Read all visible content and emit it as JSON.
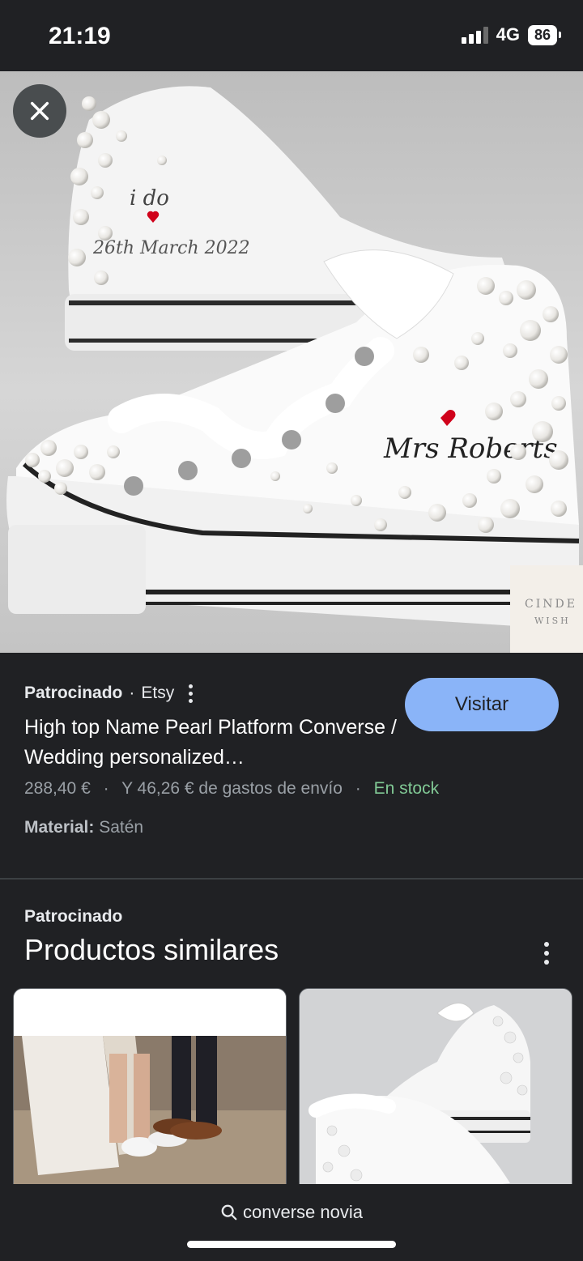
{
  "status_bar": {
    "time": "21:19",
    "network": "4G",
    "battery": "86"
  },
  "hero": {
    "image_alt": "Zapatillas Converse blancas con perlas y lazos de satén",
    "shoe_back_text_1": "i do",
    "shoe_back_text_2": "26th March 2022",
    "shoe_front_text": "Mrs Roberts",
    "watermark_line_1": "CINDE",
    "watermark_line_2": "WISH"
  },
  "listing": {
    "sponsored": "Patrocinado",
    "separator": "·",
    "merchant": "Etsy",
    "visit_label": "Visitar",
    "title": "High top Name Pearl Platform Converse / Wedding personalized…",
    "price": "288,40 €",
    "shipping": "Y 46,26 € de gastos de envío",
    "stock": "En stock",
    "material_label": "Material:",
    "material_value": "Satén"
  },
  "similar": {
    "sponsored": "Patrocinado",
    "title": "Productos similares"
  },
  "bottom": {
    "search_query": "converse novia"
  },
  "colors": {
    "background": "#202124",
    "accent": "#8ab4f8",
    "stock_green": "#81c995"
  }
}
